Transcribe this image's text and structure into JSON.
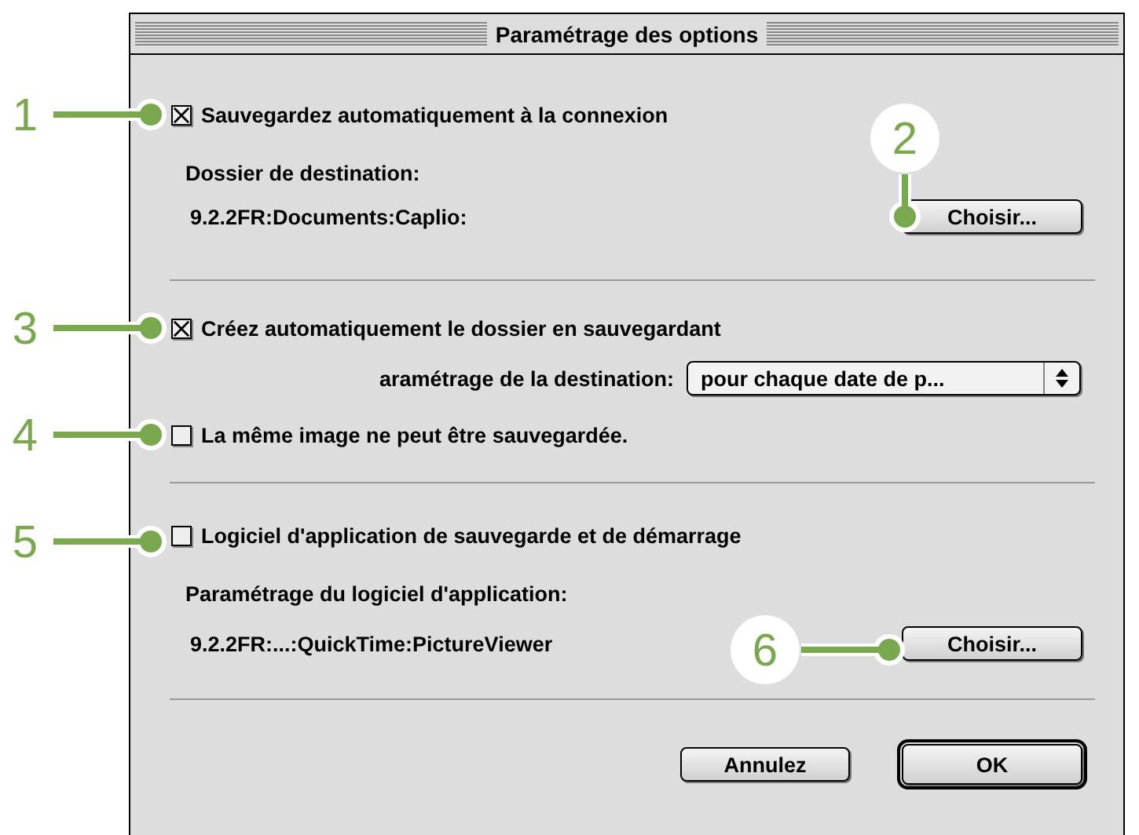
{
  "window": {
    "title": "Paramétrage des options"
  },
  "sections": [
    {
      "items": [
        {
          "kind": "checkbox",
          "label": "Sauvegardez automatiquement à la connexion",
          "checked": true
        },
        {
          "kind": "label",
          "label": "Dossier de destination:"
        },
        {
          "kind": "path",
          "path": "9.2.2FR:Documents:Caplio:",
          "button": "Choisir..."
        }
      ]
    },
    {
      "items": [
        {
          "kind": "checkbox",
          "label": "Créez automatiquement le dossier en sauvegardant",
          "checked": true
        },
        {
          "kind": "select",
          "label": "aramétrage de la destination:",
          "value": "pour chaque date de p..."
        },
        {
          "kind": "checkbox",
          "label": "La même image ne peut être sauvegardée.",
          "checked": false
        }
      ]
    },
    {
      "items": [
        {
          "kind": "checkbox",
          "label": "Logiciel d'application de sauvegarde et de démarrage",
          "checked": false
        },
        {
          "kind": "label",
          "label": "Paramétrage du logiciel d'application:"
        },
        {
          "kind": "path",
          "path": "9.2.2FR:...:QuickTime:PictureViewer",
          "button": "Choisir..."
        }
      ]
    }
  ],
  "buttons": [
    {
      "label": "Annulez",
      "default": false
    },
    {
      "label": "OK",
      "default": true
    }
  ],
  "callouts": [
    "1",
    "2",
    "3",
    "4",
    "5",
    "6"
  ]
}
